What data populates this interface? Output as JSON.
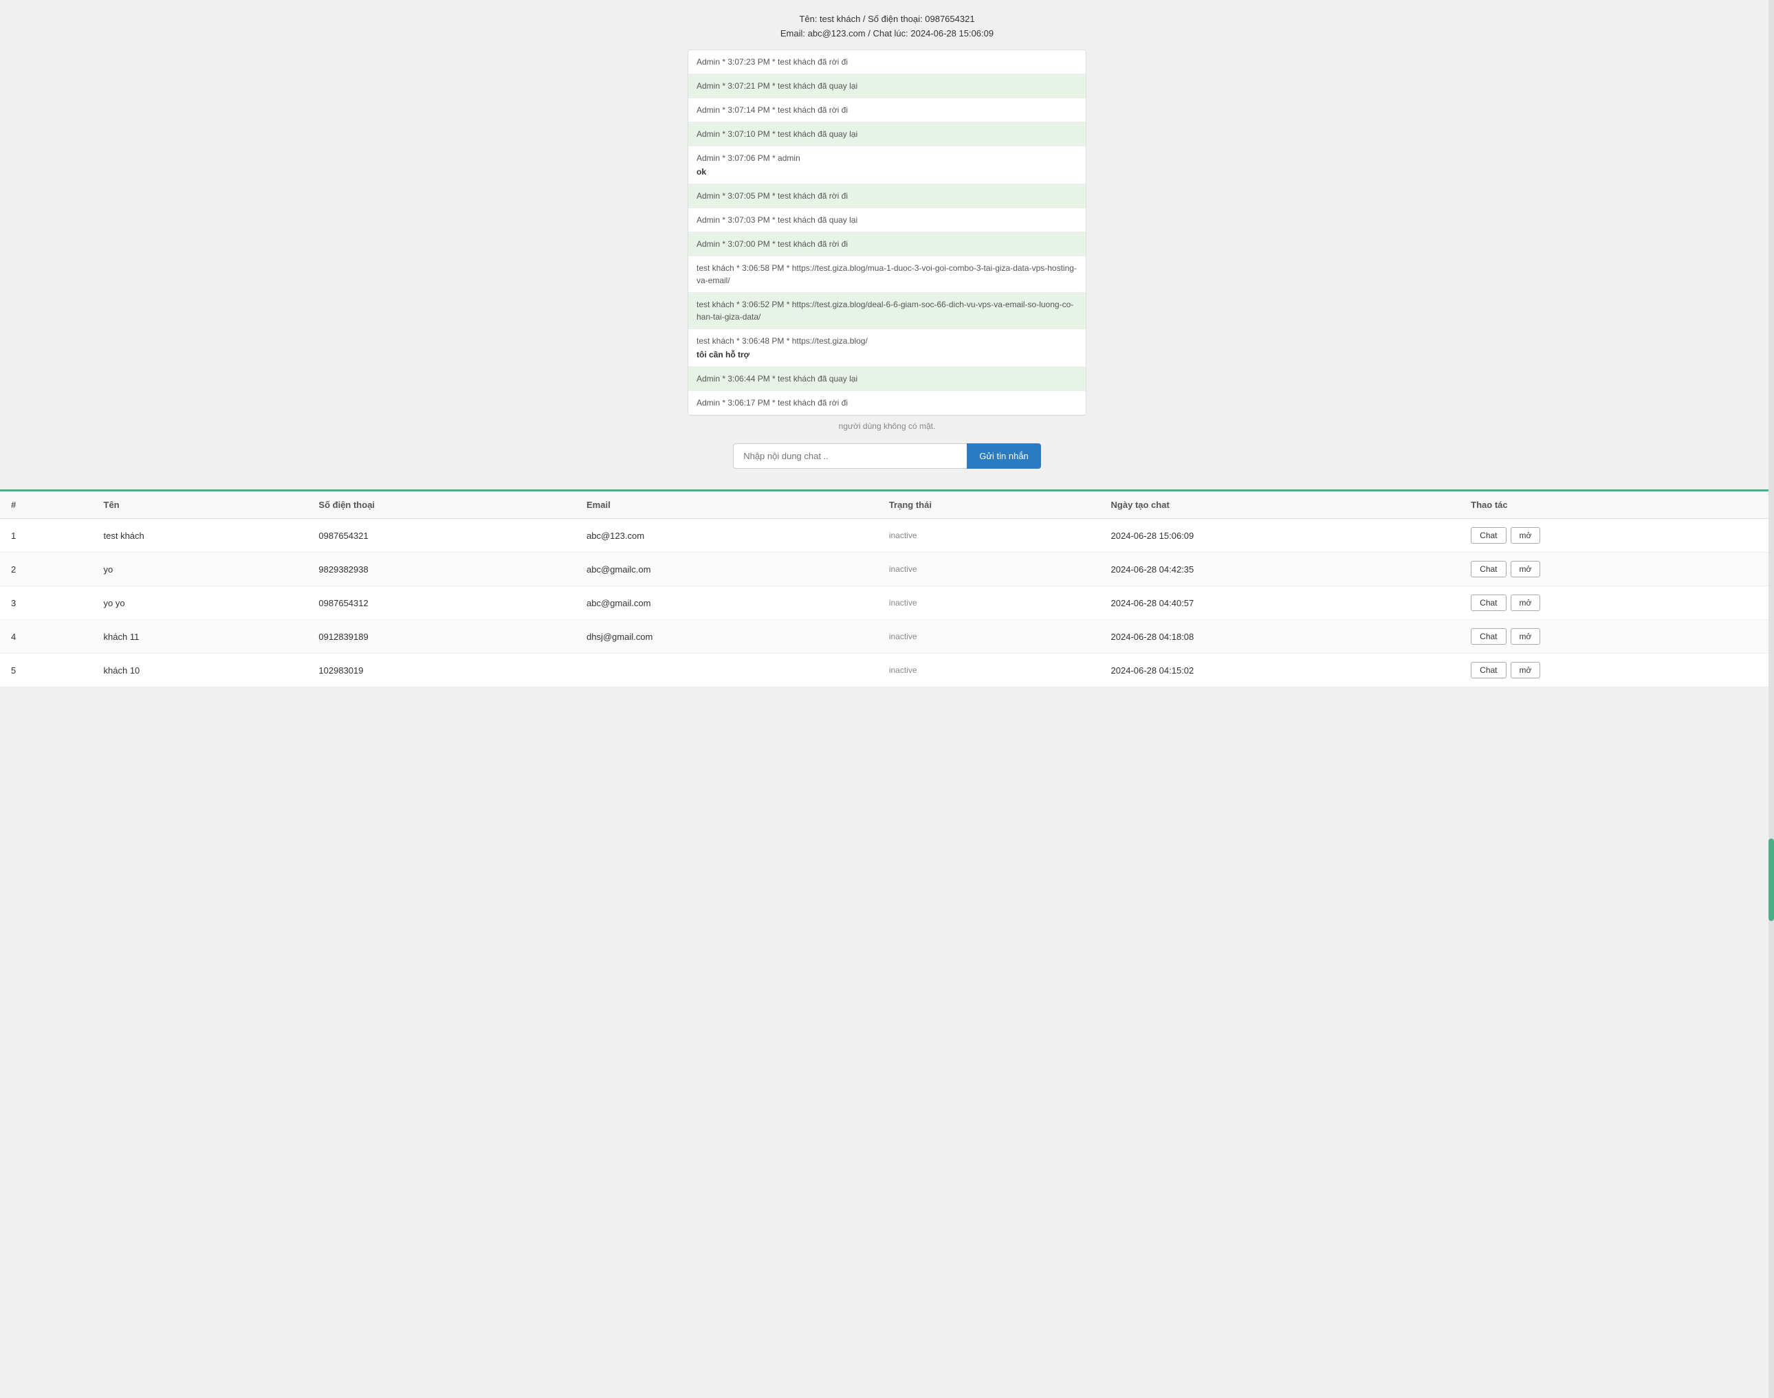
{
  "header": {
    "line1": "Tên: test khách / Số điện thoại: 0987654321",
    "line2": "Email: abc@123.com / Chat lúc: 2024-06-28 15:06:09"
  },
  "chat_messages": [
    {
      "id": 1,
      "bg": "white",
      "sender": "Admin * 3:07:23 PM *",
      "text": "test khách đã rời đi",
      "body": ""
    },
    {
      "id": 2,
      "bg": "green",
      "sender": "Admin * 3:07:21 PM *",
      "text": "test khách đã quay lại",
      "body": ""
    },
    {
      "id": 3,
      "bg": "white",
      "sender": "Admin * 3:07:14 PM *",
      "text": "test khách đã rời đi",
      "body": ""
    },
    {
      "id": 4,
      "bg": "green",
      "sender": "Admin * 3:07:10 PM *",
      "text": "test khách đã quay lại",
      "body": ""
    },
    {
      "id": 5,
      "bg": "white",
      "sender": "Admin * 3:07:06 PM *",
      "text": "admin",
      "body": "ok"
    },
    {
      "id": 6,
      "bg": "green",
      "sender": "Admin * 3:07:05 PM *",
      "text": "test khách đã rời đi",
      "body": ""
    },
    {
      "id": 7,
      "bg": "white",
      "sender": "Admin * 3:07:03 PM *",
      "text": "test khách đã quay lại",
      "body": ""
    },
    {
      "id": 8,
      "bg": "green",
      "sender": "Admin * 3:07:00 PM *",
      "text": "test khách đã rời đi",
      "body": ""
    },
    {
      "id": 9,
      "bg": "white",
      "sender": "test khách * 3:06:58 PM *",
      "text": "https://test.giza.blog/mua-1-duoc-3-voi-goi-combo-3-tai-giza-data-vps-hosting-va-email/",
      "body": ""
    },
    {
      "id": 10,
      "bg": "green",
      "sender": "test khách * 3:06:52 PM *",
      "text": "https://test.giza.blog/deal-6-6-giam-soc-66-dich-vu-vps-va-email-so-luong-co-han-tai-giza-data/",
      "body": ""
    },
    {
      "id": 11,
      "bg": "white",
      "sender": "test khách * 3:06:48 PM *",
      "text": "https://test.giza.blog/",
      "body": "tôi cần hỗ trợ"
    },
    {
      "id": 12,
      "bg": "green",
      "sender": "Admin * 3:06:44 PM *",
      "text": "test khách đã quay lại",
      "body": ""
    },
    {
      "id": 13,
      "bg": "white",
      "sender": "Admin * 3:06:17 PM *",
      "text": "test khách đã rời đi",
      "body": ""
    }
  ],
  "offline_text": "người dùng không có mặt.",
  "input": {
    "placeholder": "Nhập nội dung chat ..",
    "send_label": "Gửi tin nhắn"
  },
  "table": {
    "columns": [
      "#",
      "Tên",
      "Số điện thoại",
      "Email",
      "Trạng thái",
      "Ngày tạo chat",
      "Thao tác"
    ],
    "rows": [
      {
        "num": "1",
        "name": "test khách",
        "phone": "0987654321",
        "email": "abc@123.com",
        "status": "inactive",
        "date": "2024-06-28 15:06:09"
      },
      {
        "num": "2",
        "name": "yo",
        "phone": "9829382938",
        "email": "abc@gmailc.om",
        "status": "inactive",
        "date": "2024-06-28 04:42:35"
      },
      {
        "num": "3",
        "name": "yo yo",
        "phone": "0987654312",
        "email": "abc@gmail.com",
        "status": "inactive",
        "date": "2024-06-28 04:40:57"
      },
      {
        "num": "4",
        "name": "khách 11",
        "phone": "0912839189",
        "email": "dhsj@gmail.com",
        "status": "inactive",
        "date": "2024-06-28 04:18:08"
      },
      {
        "num": "5",
        "name": "khách 10",
        "phone": "102983019",
        "email": "",
        "status": "inactive",
        "date": "2024-06-28 04:15:02"
      }
    ],
    "btn_chat": "Chat",
    "btn_mo": "mở"
  }
}
